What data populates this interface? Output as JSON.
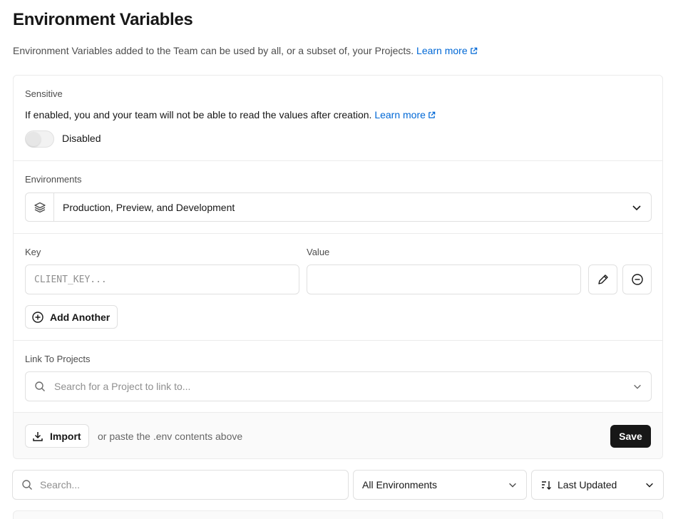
{
  "header": {
    "title": "Environment Variables",
    "description": "Environment Variables added to the Team can be used by all, or a subset of, your Projects.",
    "learn_more": "Learn more"
  },
  "sensitive": {
    "label": "Sensitive",
    "description": "If enabled, you and your team will not be able to read the values after creation.",
    "learn_more": "Learn more",
    "toggle_state": "Disabled"
  },
  "environments": {
    "label": "Environments",
    "selected": "Production, Preview, and Development"
  },
  "variables": {
    "key_label": "Key",
    "value_label": "Value",
    "key_placeholder": "CLIENT_KEY...",
    "key_value": "",
    "value_value": "",
    "add_another": "Add Another"
  },
  "link_projects": {
    "label": "Link To Projects",
    "placeholder": "Search for a Project to link to..."
  },
  "footer": {
    "import_label": "Import",
    "hint": "or paste the .env contents above",
    "save_label": "Save"
  },
  "filters": {
    "search_placeholder": "Search...",
    "environment_filter": "All Environments",
    "sort": "Last Updated"
  },
  "colors": {
    "link": "#0068d6",
    "primary_button": "#171717",
    "border": "#e0e0e0"
  }
}
